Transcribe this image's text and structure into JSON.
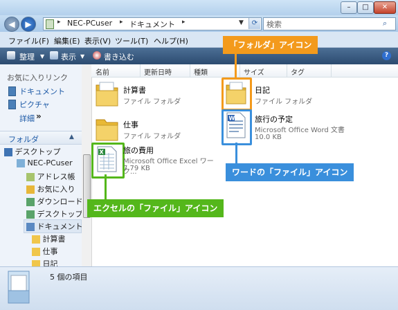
{
  "window": {
    "min_glyph": "–",
    "max_glyph": "□",
    "close_glyph": "✕"
  },
  "address": {
    "crumb_root": "NEC-PCuser",
    "crumb_sep": "▸",
    "crumb_current": "ドキュメント",
    "search_placeholder": "検索"
  },
  "menu": [
    "ファイル(F)",
    "編集(E)",
    "表示(V)",
    "ツール(T)",
    "ヘルプ(H)"
  ],
  "toolbar": {
    "organize": "整理",
    "view": "表示",
    "burn": "書き込む",
    "help_glyph": "?"
  },
  "favorites": {
    "header": "お気に入りリンク",
    "items": [
      "ドキュメント",
      "ピクチャ"
    ],
    "more": "詳細"
  },
  "folders": {
    "header": "フォルダ",
    "tree": [
      {
        "label": "デスクトップ",
        "level": 0
      },
      {
        "label": "NEC-PCuser",
        "level": 1
      },
      {
        "label": "アドレス帳",
        "level": 2
      },
      {
        "label": "お気に入り",
        "level": 2
      },
      {
        "label": "ダウンロード",
        "level": 2
      },
      {
        "label": "デスクトップ",
        "level": 2
      },
      {
        "label": "ドキュメント",
        "level": 2
      },
      {
        "label": "計算書",
        "level": 3
      },
      {
        "label": "仕事",
        "level": 3
      },
      {
        "label": "日記",
        "level": 3
      }
    ]
  },
  "columns": [
    "名前",
    "更新日時",
    "種類",
    "サイズ",
    "タグ"
  ],
  "files": [
    {
      "name": "計算書",
      "type": "ファイル フォルダ"
    },
    {
      "name": "日記",
      "type": "ファイル フォルダ"
    },
    {
      "name": "仕事",
      "type": "ファイル フォルダ"
    },
    {
      "name": "旅行の予定",
      "type": "Microsoft Office Word 文書",
      "size": "10.0 KB"
    },
    {
      "name": "旅の費用",
      "type": "Microsoft Office Excel ワーク...",
      "size": "7.79 KB"
    }
  ],
  "status": {
    "count_text": "5 個の項目"
  },
  "callouts": {
    "folder": "「フォルダ」アイコン",
    "word": "ワードの「ファイル」アイコン",
    "excel": "エクセルの「ファイル」アイコン"
  },
  "colors": {
    "folder_callout": "#f39a1c",
    "word_callout": "#3a8fdc",
    "excel_callout": "#54b71b"
  }
}
